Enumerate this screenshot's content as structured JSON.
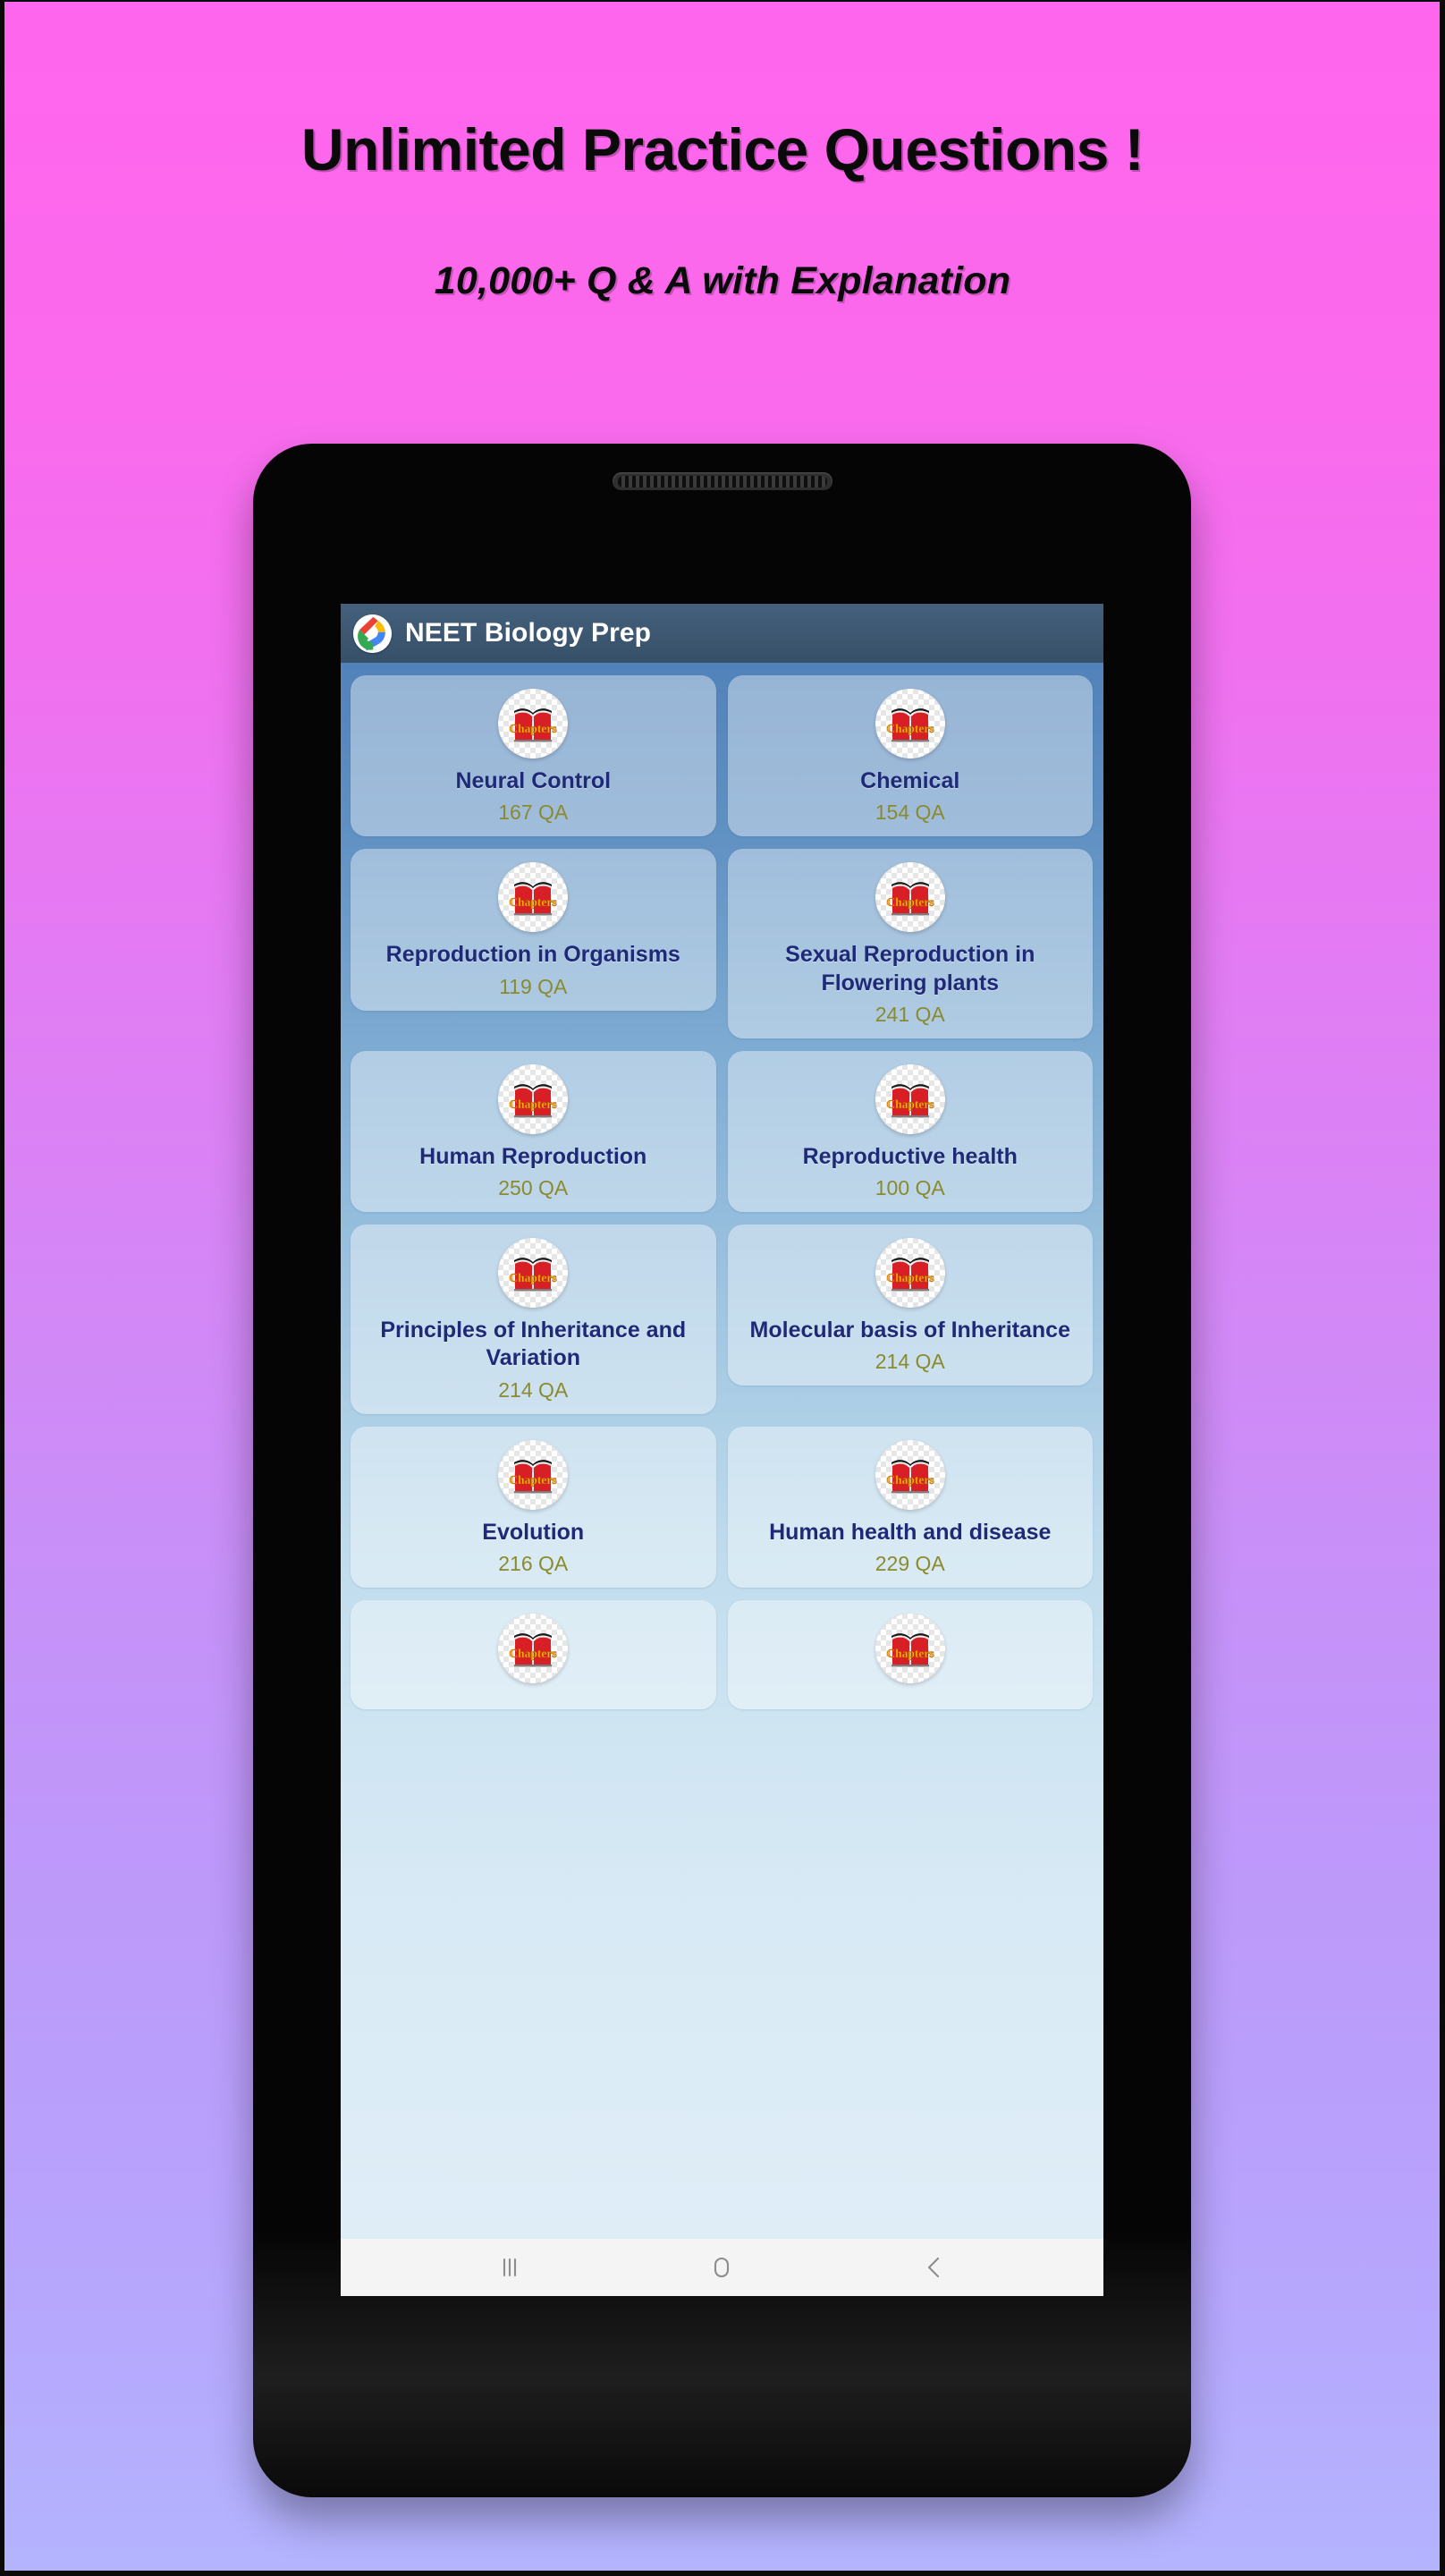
{
  "promo": {
    "headline": "Unlimited Practice Questions !",
    "subheadline": "10,000+ Q & A with Explanation",
    "bg_gradient_top": "#FF66EE",
    "bg_gradient_bottom": "#B4B4FE"
  },
  "app": {
    "title": "NEET Biology Prep",
    "appbar_color": "#3C5670",
    "icon_name": "google-swirl-app-icon",
    "title_color": "#FFFFFF"
  },
  "list": {
    "card_title_color": "#1E2A78",
    "card_count_color": "#8A8A2E",
    "card_icon_name": "chapters-book-icon",
    "chapters_label": "Chapters",
    "items": [
      {
        "title": "Neural Control",
        "count": "167 QA"
      },
      {
        "title": "Chemical",
        "count": "154 QA"
      },
      {
        "title": "Reproduction in Organisms",
        "count": "119 QA"
      },
      {
        "title": "Sexual Reproduction in Flowering plants",
        "count": "241 QA"
      },
      {
        "title": "Human Reproduction",
        "count": "250 QA"
      },
      {
        "title": "Reproductive health",
        "count": "100 QA"
      },
      {
        "title": "Principles of Inheritance and Variation",
        "count": "214 QA"
      },
      {
        "title": "Molecular basis of Inheritance",
        "count": "214 QA"
      },
      {
        "title": "Evolution",
        "count": "216 QA"
      },
      {
        "title": "Human health and disease",
        "count": "229 QA"
      },
      {
        "title": "",
        "count": ""
      },
      {
        "title": "",
        "count": ""
      }
    ]
  },
  "navbar": {
    "recents_label": "Recents",
    "home_label": "Home",
    "back_label": "Back",
    "icon_color": "#8A8A8A",
    "background": "#F4F4F4"
  }
}
